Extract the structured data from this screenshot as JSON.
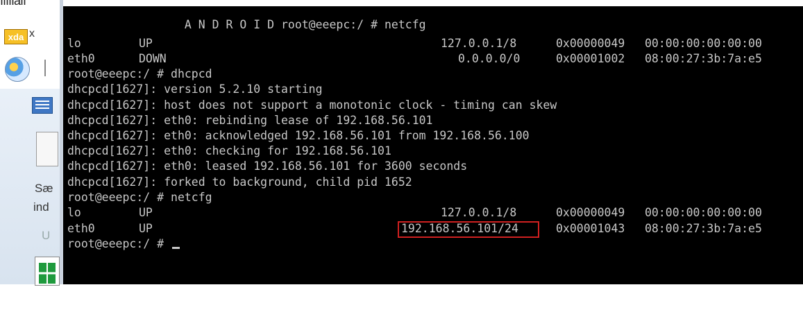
{
  "background": {
    "top_text": "ıııııaıı",
    "taskbar_xda_label": "xda",
    "taskbar_xda_suffix": "x",
    "panel_text_1": "Sæ",
    "panel_text_2": "ind",
    "panel_text_3": "U",
    "icons": [
      "xda-logo-icon",
      "paint-icon",
      "list-icon",
      "document-icon",
      "spreadsheet-icon"
    ]
  },
  "terminal": {
    "colors": {
      "background": "#000000",
      "text": "#c8c8c8",
      "highlight": "#d02020"
    },
    "lines": [
      {
        "text": "                 A N D R O I D root@eeepc:/ # netcfg"
      },
      {
        "cols": [
          "lo",
          "UP",
          "127.0.0.1/8",
          "0x00000049",
          "00:00:00:00:00:00"
        ]
      },
      {
        "cols": [
          "eth0",
          "DOWN",
          "0.0.0.0/0",
          "0x00001002",
          "08:00:27:3b:7a:e5"
        ]
      },
      {
        "text": "root@eeepc:/ # dhcpcd"
      },
      {
        "text": "dhcpcd[1627]: version 5.2.10 starting"
      },
      {
        "text": "dhcpcd[1627]: host does not support a monotonic clock - timing can skew"
      },
      {
        "text": "dhcpcd[1627]: eth0: rebinding lease of 192.168.56.101"
      },
      {
        "text": "dhcpcd[1627]: eth0: acknowledged 192.168.56.101 from 192.168.56.100"
      },
      {
        "text": "dhcpcd[1627]: eth0: checking for 192.168.56.101"
      },
      {
        "text": "dhcpcd[1627]: eth0: leased 192.168.56.101 for 3600 seconds"
      },
      {
        "text": "dhcpcd[1627]: forked to background, child pid 1652"
      },
      {
        "text": "root@eeepc:/ # netcfg"
      },
      {
        "cols": [
          "lo",
          "UP",
          "127.0.0.1/8",
          "0x00000049",
          "00:00:00:00:00:00"
        ]
      },
      {
        "cols": [
          "eth0",
          "UP",
          "192.168.56.101/24",
          "0x00001043",
          "08:00:27:3b:7a:e5"
        ]
      },
      {
        "text": "root@eeepc:/ # "
      }
    ]
  }
}
